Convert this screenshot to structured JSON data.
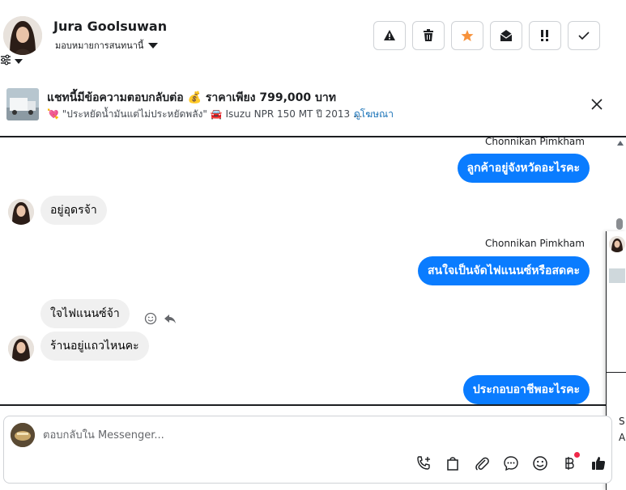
{
  "header": {
    "contact_name": "Jura Goolsuwan",
    "assign_label": "มอบหมายการสนทนานี้",
    "actions": [
      {
        "name": "report-button",
        "icon": "warning-icon"
      },
      {
        "name": "delete-button",
        "icon": "trash-icon"
      },
      {
        "name": "star-button",
        "icon": "star-icon"
      },
      {
        "name": "mark-unread-button",
        "icon": "envelope-open-icon"
      },
      {
        "name": "follow-up-button",
        "icon": "exclamation-icon"
      },
      {
        "name": "done-button",
        "icon": "check-icon"
      }
    ],
    "star_color": "#f7923b"
  },
  "ad": {
    "title": "แชทนี้มีข้อความตอบกลับต่อ 💰 ราคาเพียง 799,000 บาท",
    "subtitle": "💘 \"ประหยัดน้ำมันแต่ไม่ประหยัดพลัง\" 🚘 Isuzu NPR 150 MT ปี 2013 ...",
    "link": "ดูโฆษณา"
  },
  "messages": {
    "sender_name_1": "Chonnikan Pimkham",
    "out_1": "ลูกค้าอยู่จังหวัดอะไรคะ",
    "in_1": "อยู่อุดรจ้า",
    "sender_name_2": "Chonnikan Pimkham",
    "out_2": "สนใจเป็นจัดไฟแนนซ์หรือสดคะ",
    "in_2": "ใจไฟแนนซ์จ้า",
    "in_3": "ร้านอยู่แถวไหนคะ",
    "out_3": "ประกอบอาชีพอะไรคะ"
  },
  "side_peek": {
    "text_1": "S",
    "text_2": "A"
  },
  "composer": {
    "placeholder": "ตอบกลับใน Messenger..."
  },
  "colors": {
    "accent": "#0a7cff",
    "incoming": "#f0f0f0",
    "link": "#1a73b8",
    "badge": "#f02849"
  }
}
